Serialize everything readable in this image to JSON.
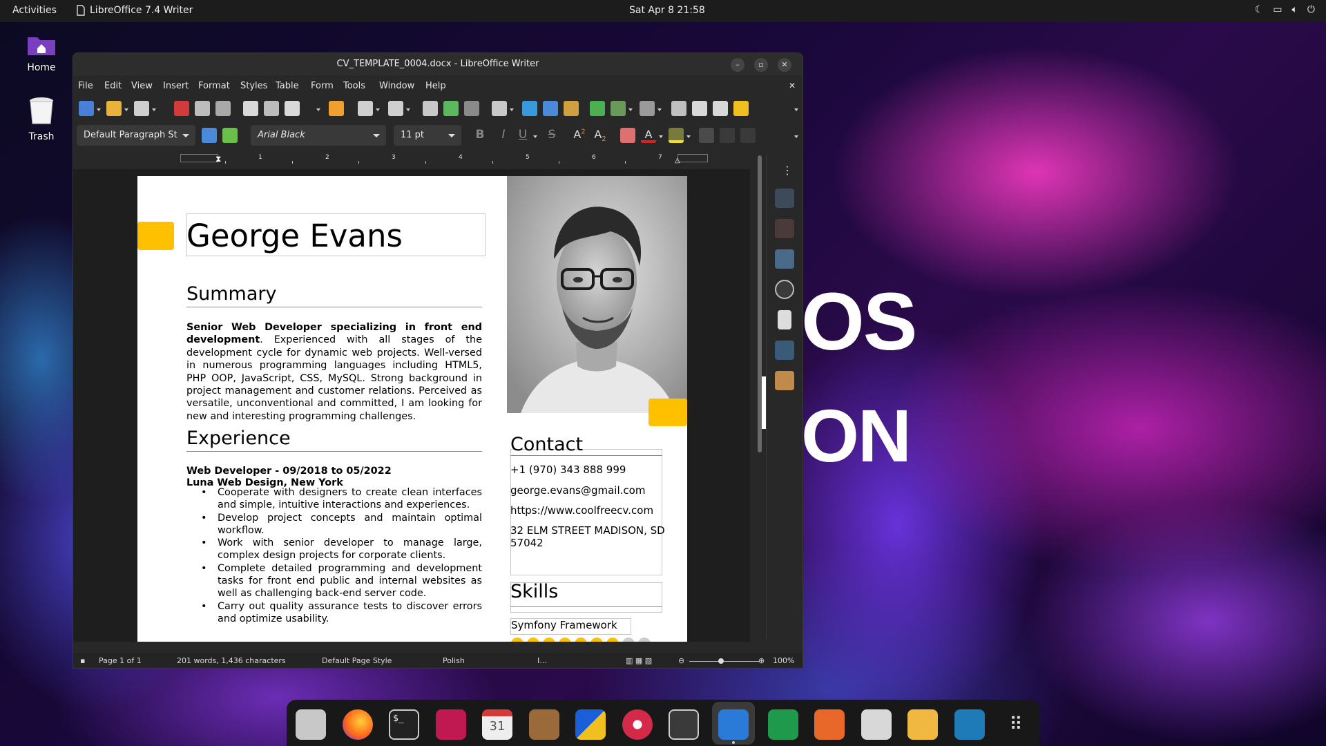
{
  "topbar": {
    "activities": "Activities",
    "app_name": "LibreOffice 7.4 Writer",
    "clock": "Sat Apr 8  21:58"
  },
  "desktop": {
    "home_label": "Home",
    "trash_label": "Trash",
    "wallpaper_text_1": "OS",
    "wallpaper_text_2": "ON"
  },
  "window": {
    "title": "CV_TEMPLATE_0004.docx - LibreOffice Writer"
  },
  "menubar": [
    "File",
    "Edit",
    "View",
    "Insert",
    "Format",
    "Styles",
    "Table",
    "Form",
    "Tools",
    "Window",
    "Help"
  ],
  "formatting": {
    "paragraph_style": "Default Paragraph St",
    "font_name": "Arial Black",
    "font_size": "11 pt"
  },
  "ruler": [
    "1",
    "2",
    "3",
    "4",
    "5",
    "6",
    "7"
  ],
  "document": {
    "name": "George Evans",
    "summary_heading": "Summary",
    "summary_bold": "Senior Web Developer specializing in front end development",
    "summary_rest": ". Experienced with all stages of the development cycle for dynamic web projects. Well-versed in numerous programming languages including HTML5, PHP OOP, JavaScript, CSS, MySQL. Strong background in project management and customer relations. Perceived as versatile, unconventional and committed, I am looking for new and interesting programming challenges.",
    "experience_heading": "Experience",
    "job_title": "Web Developer - 09/2018 to 05/2022",
    "job_company": "Luna Web Design, New York",
    "job_bullets": [
      "Cooperate with designers to create clean interfaces and simple, intuitive interactions and experiences.",
      "Develop project concepts and maintain optimal workflow.",
      "Work with senior developer to manage large, complex design projects for corporate clients.",
      "Complete detailed programming and development tasks for front end public and internal websites as well as challenging back-end server code.",
      "Carry out quality assurance tests to discover errors and optimize usability."
    ],
    "contact_heading": "Contact",
    "contact_phone": "+1 (970) 343 888 999",
    "contact_email": "george.evans@gmail.com",
    "contact_web": "https://www.coolfreecv.com",
    "contact_address_1": "32 ELM STREET MADISON, SD",
    "contact_address_2": "57042",
    "skills_heading": "Skills",
    "skill_1_name": "Symfony Framework",
    "skill_1_level": 7,
    "skill_1_max": 9
  },
  "statusbar": {
    "page": "Page 1 of 1",
    "words": "201 words, 1,436 characters",
    "page_style": "Default Page Style",
    "language": "Polish",
    "zoom": "100%"
  },
  "colors": {
    "accent_yellow": "#ffc000",
    "skill_dot_empty": "#cccccc"
  },
  "dock": [
    "files-icon",
    "firefox-icon",
    "terminal-icon",
    "text-editor-icon",
    "calendar-icon",
    "contacts-icon",
    "media-player-icon",
    "ubuntu-icon",
    "video-icon",
    "writer-icon",
    "calc-icon",
    "impress-icon",
    "software-icon",
    "mail-icon",
    "settings-icon",
    "app-grid-icon"
  ],
  "dock_calendar_day": "31"
}
